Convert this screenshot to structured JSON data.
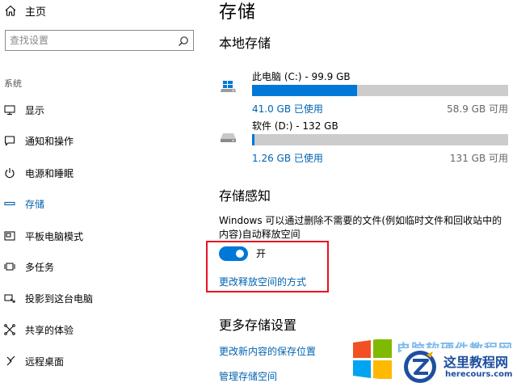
{
  "sidebar": {
    "home_label": "主页",
    "search_placeholder": "查找设置",
    "section_label": "系统",
    "items": [
      {
        "label": "显示",
        "icon": "monitor-icon"
      },
      {
        "label": "通知和操作",
        "icon": "notification-icon"
      },
      {
        "label": "电源和睡眠",
        "icon": "power-icon"
      },
      {
        "label": "存储",
        "icon": "storage-icon",
        "active": true
      },
      {
        "label": "平板电脑模式",
        "icon": "tablet-mode-icon"
      },
      {
        "label": "多任务",
        "icon": "multitasking-icon"
      },
      {
        "label": "投影到这台电脑",
        "icon": "projecting-icon"
      },
      {
        "label": "共享的体验",
        "icon": "shared-experiences-icon"
      },
      {
        "label": "远程桌面",
        "icon": "remote-desktop-icon"
      }
    ]
  },
  "main": {
    "title": "存储",
    "local_storage_heading": "本地存储",
    "drives": [
      {
        "name": "此电脑 (C:) - 99.9 GB",
        "used": "41.0 GB 已使用",
        "free": "58.9 GB 可用",
        "used_fraction": 0.41,
        "icon": "windows-drive-icon"
      },
      {
        "name": "软件 (D:) - 132 GB",
        "used": "1.26 GB 已使用",
        "free": "131 GB 可用",
        "used_fraction": 0.0095,
        "icon": "hard-drive-icon"
      }
    ],
    "storage_sense": {
      "heading": "存储感知",
      "description": "Windows 可以通过删除不需要的文件(例如临时文件和回收站中的内容)自动释放空间",
      "toggle_state": "开",
      "toggle_on": true,
      "change_link": "更改释放空间的方式"
    },
    "more_settings": {
      "heading": "更多存储设置",
      "links": [
        "更改新内容的保存位置",
        "管理存储空间"
      ]
    }
  },
  "watermark": {
    "faded_text": "电脑软硬件教程网",
    "site_name": "这里教程网",
    "site_url": "herecours.com"
  },
  "colors": {
    "accent": "#0078d7",
    "link": "#0063b1",
    "highlight_border": "#e81123",
    "bar_track": "#cccccc"
  }
}
